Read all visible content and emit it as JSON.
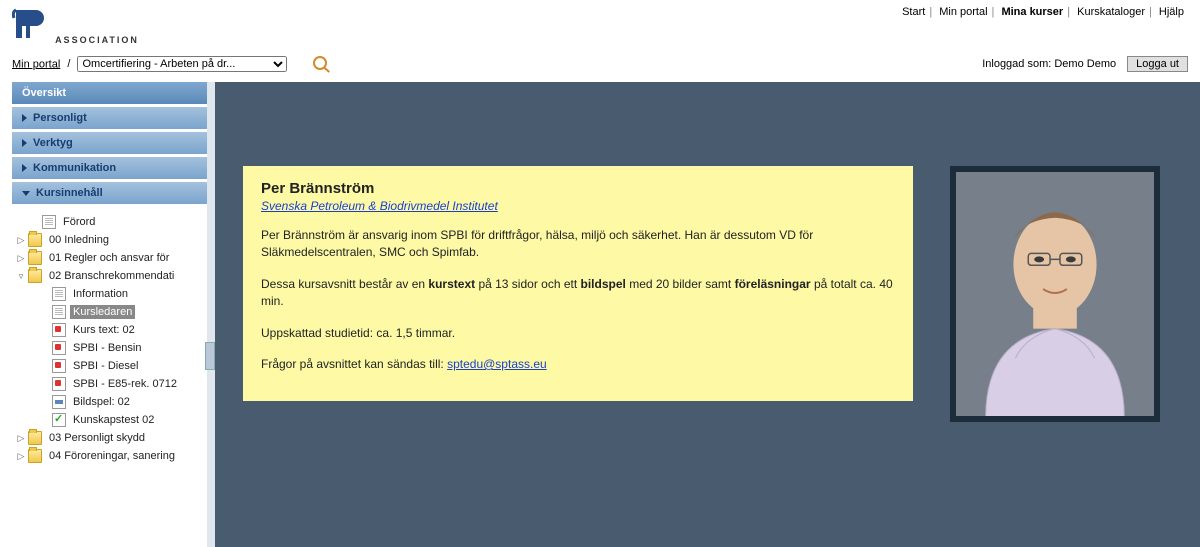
{
  "brand": {
    "association": "ASSOCIATION"
  },
  "topnav": {
    "start": "Start",
    "min_portal": "Min portal",
    "mina_kurser": "Mina kurser",
    "kurskataloger": "Kurskataloger",
    "hjalp": "Hjälp"
  },
  "breadcrumb": {
    "portal_link": "Min portal",
    "slash": "/",
    "select_value": "Omcertifiering - Arbeten på dr..."
  },
  "session": {
    "logged_in_as_label": "Inloggad som: ",
    "user": "Demo Demo",
    "logout": "Logga ut"
  },
  "sidebar": {
    "header": "Översikt",
    "personligt": "Personligt",
    "verktyg": "Verktyg",
    "kommunikation": "Kommunikation",
    "kursinnehall": "Kursinnehåll",
    "tree": {
      "forord": "Förord",
      "n00": "00 Inledning",
      "n01": "01 Regler och ansvar för",
      "n02": "02 Branschrekommendati",
      "info": "Information",
      "kursledaren": "Kursledaren",
      "kurstext": "Kurs text: 02",
      "bensin": "SPBI - Bensin",
      "diesel": "SPBI - Diesel",
      "e85": "SPBI - E85-rek. 0712",
      "bildspel": "Bildspel: 02",
      "kunskap": "Kunskapstest 02",
      "n03": "03 Personligt skydd",
      "n04": "04 Föroreningar, sanering"
    }
  },
  "content": {
    "title": "Per Brännström",
    "subtitle": "Svenska Petroleum & Biodrivmedel Institutet",
    "p1a": "Per Brännström är ansvarig inom SPBI för driftfrågor, hälsa, miljö och säkerhet. Han är dessutom VD för Släkmedelscentralen, SMC och Spimfab.",
    "p2_pre": "Dessa kursavsnitt består av en ",
    "p2_b1": "kurstext",
    "p2_mid": " på 13 sidor och ett ",
    "p2_b2": "bildspel",
    "p2_mid2": " med 20 bilder samt ",
    "p2_b3": "föreläsningar",
    "p2_post": " på totalt ca. 40 min.",
    "p3": "Uppskattad studietid: ca. 1,5 timmar.",
    "p4_pre": "Frågor på avsnittet kan sändas till: ",
    "email": "sptedu@sptass.eu"
  }
}
